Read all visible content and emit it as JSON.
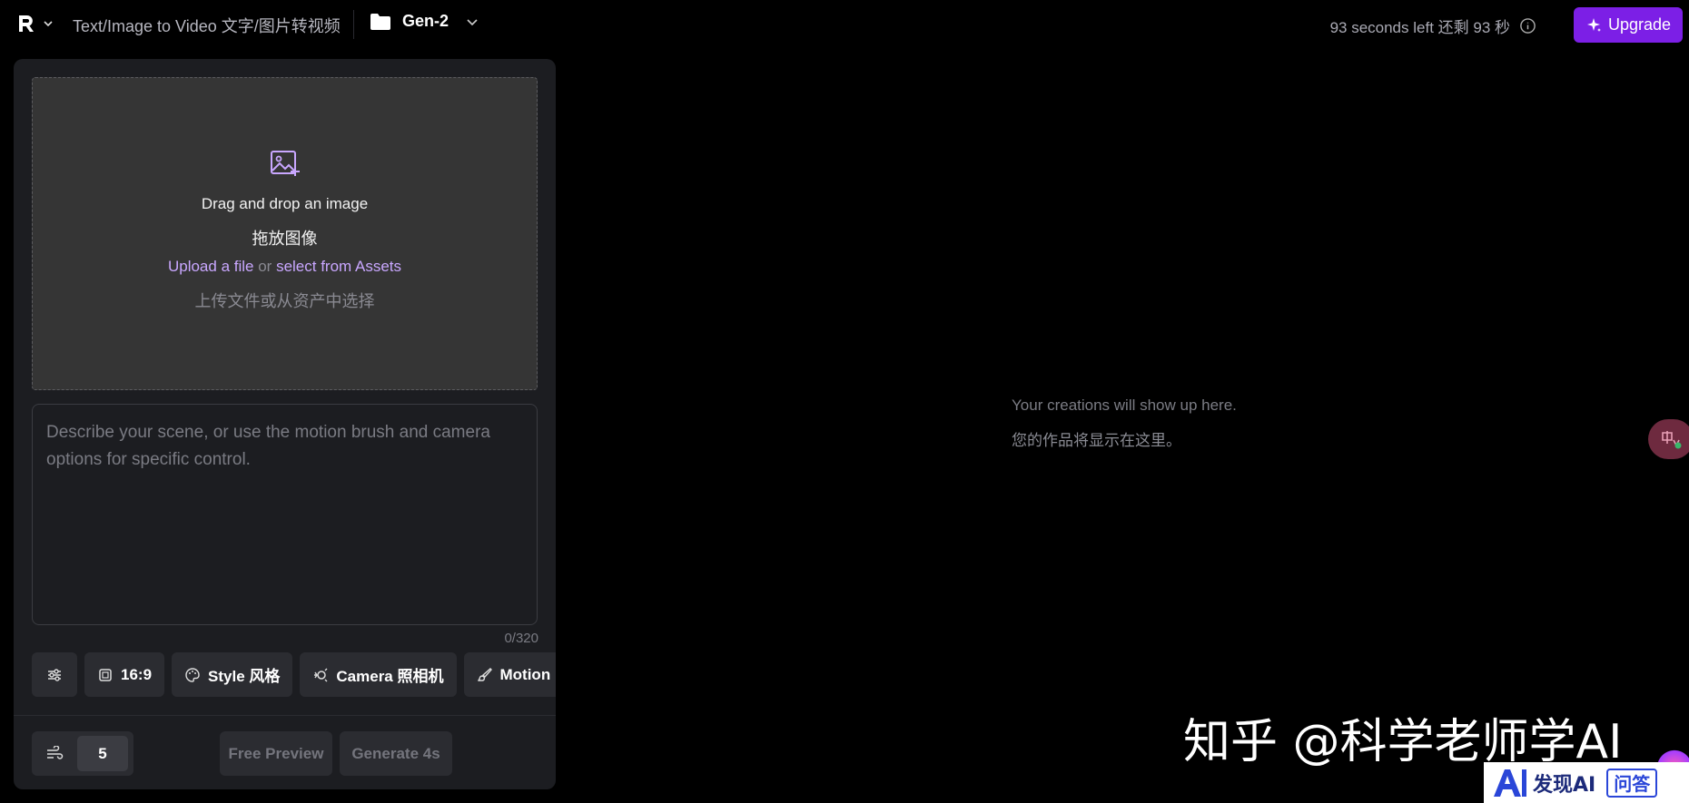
{
  "header": {
    "breadcrumb": "Text/Image to Video 文字/图片转视频",
    "project_name": "Gen-2",
    "timer": "93 seconds left 还剩 93 秒",
    "upgrade_label": "Upgrade"
  },
  "dropzone": {
    "title": "Drag and drop an image",
    "title_cn": "拖放图像",
    "upload_link": "Upload a file",
    "or": "or",
    "assets_link": "select from Assets",
    "subtitle_cn": "上传文件或从资产中选择"
  },
  "prompt": {
    "placeholder": "Describe your scene, or use the motion brush and camera options for specific control.",
    "counter": "0/320"
  },
  "toolbar": {
    "aspect_label": "16:9",
    "style_label": "Style 风格",
    "camera_label": "Camera 照相机",
    "motion_label": "Motion"
  },
  "footer": {
    "duration_value": "5",
    "preview_label": "Free Preview",
    "generate_label": "Generate 4s"
  },
  "output": {
    "empty_line1": "Your creations will show up here.",
    "empty_line2": "您的作品将显示在这里。"
  },
  "overlays": {
    "watermark": "知乎 @科学老师学AI",
    "badge_text": "发现AI",
    "badge_qa": "问答"
  },
  "colors": {
    "accent": "#7c1fe6",
    "link": "#c9a7ff",
    "panel": "#1c1d21",
    "button": "#2b2c31"
  }
}
